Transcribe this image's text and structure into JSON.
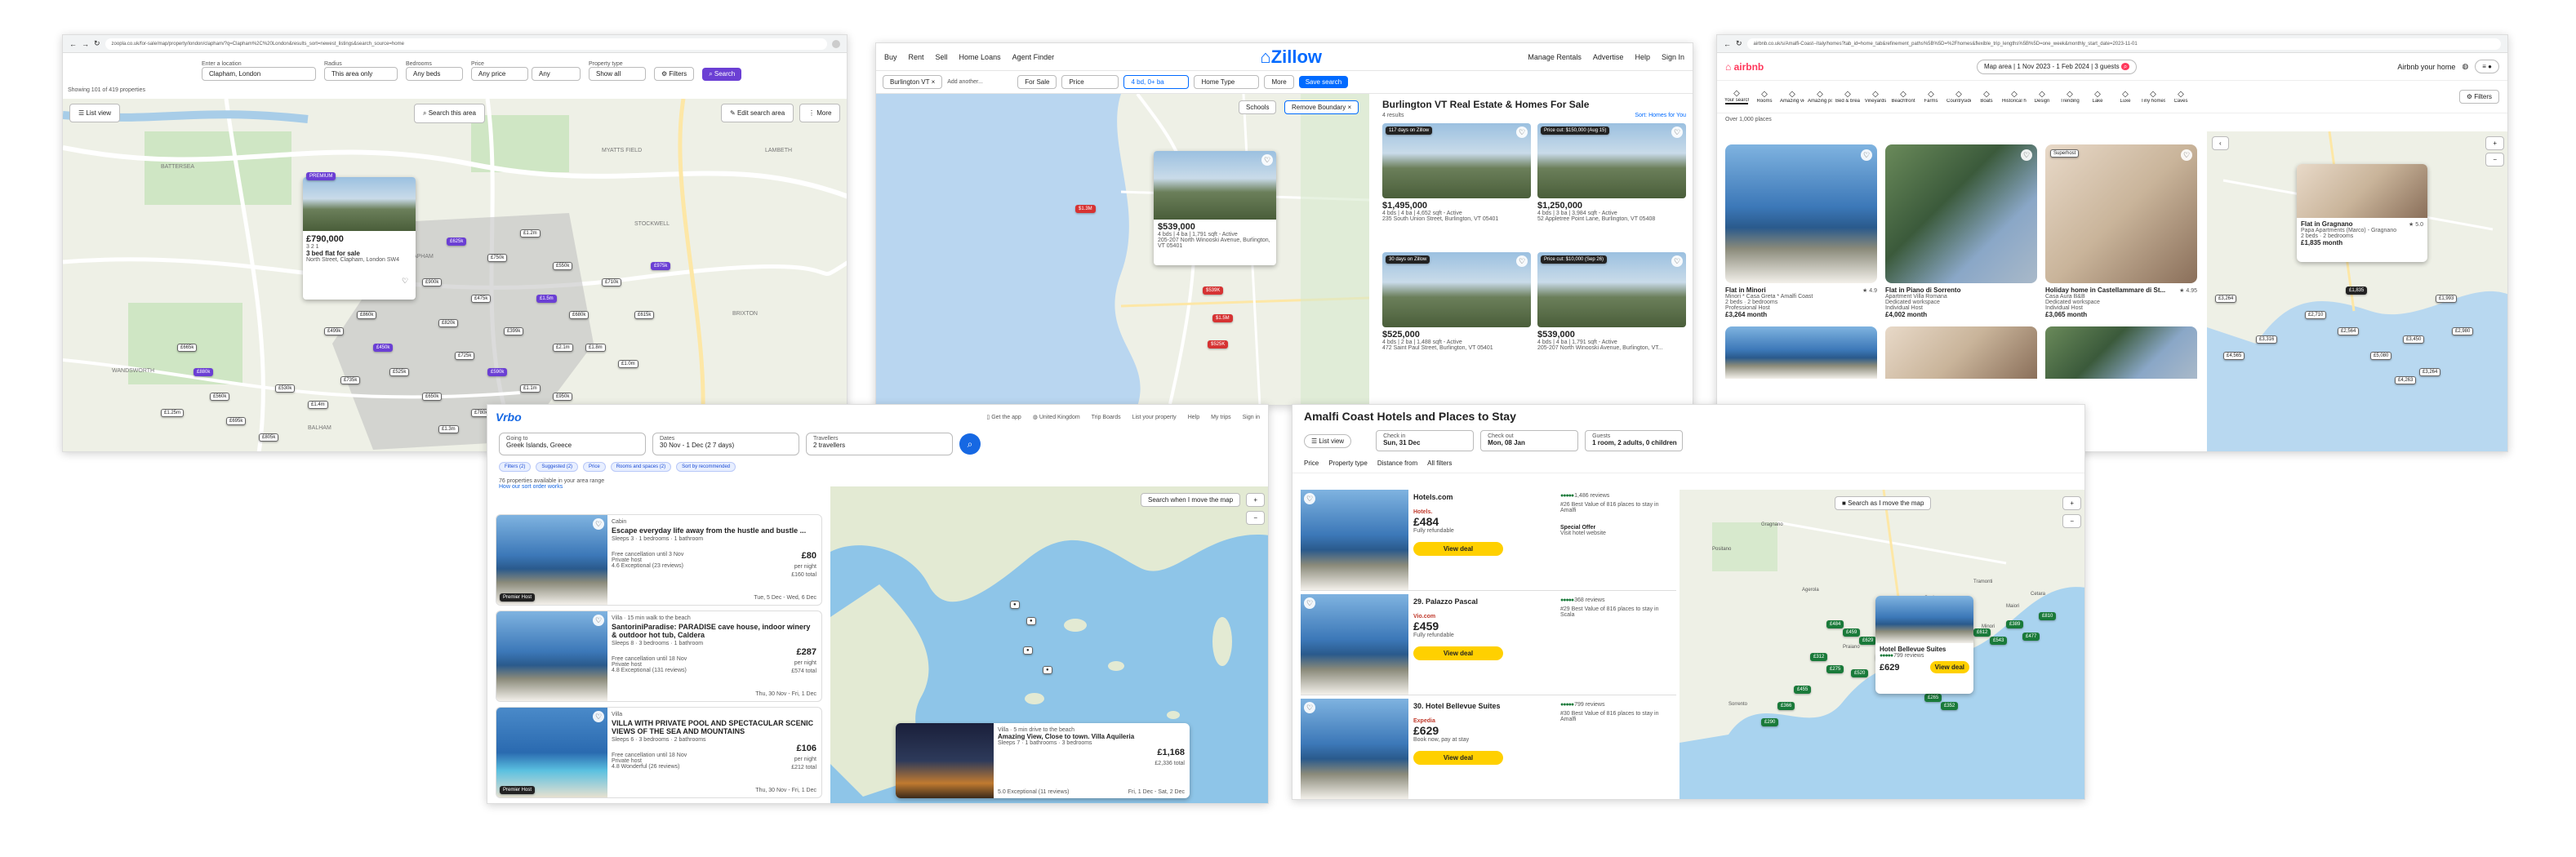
{
  "zoopla": {
    "url": "zoopla.co.uk/for-sale/map/property/london/clapham/?q=Clapham%2C%20London&results_sort=newest_listings&search_source=home",
    "location_label": "Enter a location",
    "location_value": "Clapham, London",
    "radius_label": "Radius",
    "radius_value": "This area only",
    "bedrooms_label": "Bedrooms",
    "bedrooms_value": "Any beds",
    "price_label": "Price",
    "price_min": "Any price",
    "price_max": "Any",
    "property_type_label": "Property type",
    "property_type_value": "Show all",
    "filters_label": "Filters",
    "search_label": "Search",
    "results_count": "Showing 101 of 419 properties",
    "list_view": "List view",
    "search_area": "Search this area",
    "edit_search": "Edit search area",
    "more": "More",
    "card_badge": "PREMIUM",
    "card_price": "£790,000",
    "card_features": "3  2  1",
    "card_title": "3 bed flat for sale",
    "card_address": "North Street, Clapham, London SW4",
    "pins": [
      "£625k",
      "£750k",
      "£1.2m",
      "£550k",
      "£900k",
      "£475k",
      "£1.5m",
      "£680k",
      "£820k",
      "£399k",
      "£2.1m",
      "£725k",
      "£590k",
      "£1.1m",
      "£650k",
      "£950k",
      "£780k",
      "£1.3m",
      "£450k",
      "£860k",
      "£525k",
      "£1.8m",
      "£710k",
      "£615k",
      "£975k",
      "£1.0m",
      "£735k",
      "£499k",
      "£1.4m",
      "£665k",
      "£880k",
      "£560k",
      "£1.25m",
      "£695k",
      "£805k",
      "£530k"
    ],
    "districts": [
      "BATTERSEA",
      "CLAPHAM",
      "STOCKWELL",
      "BRIXTON",
      "BALHAM",
      "WANDSWORTH",
      "MYATTS FIELD",
      "LAMBETH"
    ]
  },
  "zillow": {
    "nav": [
      "Buy",
      "Rent",
      "Sell",
      "Home Loans",
      "Agent Finder"
    ],
    "logo": "Zillow",
    "nav_right": [
      "Manage Rentals",
      "Advertise",
      "Help",
      "Sign In"
    ],
    "search_chip": "Burlington VT",
    "search_placeholder": "Add another...",
    "filters": [
      "For Sale",
      "Price",
      "4 bd, 0+ ba",
      "Home Type",
      "More"
    ],
    "save_search": "Save search",
    "schools": "Schools",
    "remove_boundary": "Remove Boundary",
    "heading": "Burlington VT Real Estate & Homes For Sale",
    "results": "4 results",
    "sort": "Sort: Homes for You",
    "map_popup_price": "$539,000",
    "map_popup_details": "4 bds | 4 ba | 1,791 sqft - Active",
    "map_popup_address": "205-207 North Winooski Avenue, Burlington, VT 05401",
    "map_pins": [
      "$1.3M",
      "$1.5M",
      "$525K",
      "$539K"
    ],
    "listings": [
      {
        "badge": "117 days on Zillow",
        "price": "$1,495,000",
        "details": "4 bds | 4 ba | 4,652 sqft - Active",
        "address": "235 South Union Street, Burlington, VT 05401"
      },
      {
        "badge": "Price cut: $150,000 (Aug 15)",
        "price": "$1,250,000",
        "details": "4 bds | 3 ba | 3,984 sqft - Active",
        "address": "52 Appletree Point Lane, Burlington, VT 05408"
      },
      {
        "badge": "30 days on Zillow",
        "price": "$525,000",
        "details": "4 bds | 2 ba | 1,488 sqft - Active",
        "address": "472 Saint Paul Street, Burlington, VT 05401"
      },
      {
        "badge": "Price cut: $10,000 (Sep 26)",
        "price": "$539,000",
        "details": "4 bds | 4 ba | 1,791 sqft - Active",
        "address": "205-207 North Winooski Avenue, Burlington, VT..."
      }
    ]
  },
  "airbnb": {
    "url": "airbnb.co.uk/s/Amalfi-Coast--Italy/homes?tab_id=home_tab&refinement_paths%5B%5D=%2Fhomes&flexible_trip_lengths%5B%5D=one_week&monthly_start_date=2023-11-01",
    "logo": "airbnb",
    "search_pill": [
      "Map area",
      "1 Nov 2023 - 1 Feb 2024",
      "3 guests"
    ],
    "airbnb_your_home": "Airbnb your home",
    "categories": [
      "Your search",
      "Rooms",
      "Amazing views",
      "Amazing pools",
      "Bed & breakfasts",
      "Vineyards",
      "Beachfront",
      "Farms",
      "Countryside",
      "Boats",
      "Historical homes",
      "Design",
      "Trending",
      "Lake",
      "Luxe",
      "Tiny homes",
      "Caves"
    ],
    "filters": "Filters",
    "places_count": "Over 1,000 places",
    "listings": [
      {
        "title": "Flat in Minori",
        "rating": "4.9",
        "desc": "Minori * Casa Greta * Amalfi Coast",
        "beds": "2 beds · 2 bedrooms",
        "host": "Professional Host",
        "price": "£3,264 month",
        "badge": ""
      },
      {
        "title": "Flat in Piano di Sorrento",
        "rating": "",
        "desc": "Apartment Villa Romana",
        "beds": "Dedicated workspace",
        "host": "Individual Host",
        "price": "£4,002 month",
        "badge": ""
      },
      {
        "title": "Holiday home in Castellammare di St...",
        "rating": "4.95",
        "desc": "Casa Aura B&B",
        "beds": "Dedicated workspace",
        "host": "Individual Host",
        "price": "£3,065 month",
        "badge": "Superhost"
      }
    ],
    "map_popup_title": "Flat in Gragnano",
    "map_popup_rating": "5.0",
    "map_popup_desc": "Papa Apartments (Marco) - Gragnano",
    "map_popup_beds": "2 beds · 2 bedrooms",
    "map_popup_price": "£1,835 month",
    "map_pins": [
      "£1,835",
      "£1,993",
      "£3,264",
      "£2,710",
      "£2,564",
      "£3,316",
      "£4,565",
      "£3,450",
      "£2,980",
      "£5,080",
      "£3,264",
      "£4,263"
    ]
  },
  "vrbo": {
    "logo": "Vrbo",
    "nav": [
      "Get the app",
      "United Kingdom",
      "Trip Boards",
      "List your property",
      "Help",
      "My trips",
      "Sign in"
    ],
    "going_to_label": "Going to",
    "going_to_value": "Greek Islands, Greece",
    "dates_label": "Dates",
    "dates_value": "30 Nov - 1 Dec (2 7 days)",
    "travellers_label": "Travellers",
    "travellers_value": "2 travellers",
    "filter_chips": [
      "Filters (2)",
      "Suggested (2)",
      "Price",
      "Rooms and spaces (2)",
      "Sort by recommended"
    ],
    "count": "76 properties available in your area range",
    "sub_count": "How our sort order works",
    "search_as_move": "Search when I move the map",
    "listings": [
      {
        "type": "Cabin",
        "title": "Escape everyday life away from the hustle and bustle ...",
        "sleeps": "Sleeps 3 · 1 bedrooms · 1 bathroom",
        "cancel": "Free cancellation until 3 Nov",
        "pool": "Private host",
        "rating": "4.6 Exceptional (23 reviews)",
        "price": "£80",
        "price_sub": "per night",
        "total": "£160 total",
        "dates": "Tue, 5 Dec - Wed, 6 Dec",
        "badge": "Premier Host"
      },
      {
        "type": "Villa · 15 min walk to the beach",
        "title": "SantoriniParadise: PARADISE cave house, indoor winery & outdoor hot tub, Caldera",
        "sleeps": "Sleeps 8 · 3 bedrooms · 1 bathroom",
        "cancel": "Free cancellation until 18 Nov",
        "pool": "Private host",
        "rating": "4.8 Exceptional (131 reviews)",
        "price": "£287",
        "price_sub": "per night",
        "total": "£574 total",
        "dates": "Thu, 30 Nov - Fri, 1 Dec",
        "badge": ""
      },
      {
        "type": "Villa",
        "title": "VILLA WITH PRIVATE POOL AND SPECTACULAR SCENIC VIEWS OF THE SEA AND MOUNTAINS",
        "sleeps": "Sleeps 6 · 3 bedrooms · 2 bathrooms",
        "cancel": "Free cancellation until 18 Nov",
        "pool": "Private host",
        "rating": "4.8 Wonderful (26 reviews)",
        "price": "£106",
        "price_sub": "per night",
        "total": "£212 total",
        "dates": "Thu, 30 Nov - Fri, 1 Dec",
        "badge": "Premier Host"
      }
    ],
    "map_card_type": "Villa · 5 min drive to the beach",
    "map_card_title": "Amazing View, Close to town. Villa Aquileria",
    "map_card_sleeps": "Sleeps 7 · 1 bathrooms · 3 bedrooms",
    "map_card_price": "£1,168",
    "map_card_total": "£2,336 total",
    "map_card_rating": "5.0 Exceptional (11 reviews)",
    "map_card_dates": "Fri, 1 Dec - Sat, 2 Dec"
  },
  "hotels": {
    "title": "Amalfi Coast Hotels and Places to Stay",
    "list_view": "List view",
    "checkin_label": "Check in",
    "checkin_value": "Sun, 31 Dec",
    "checkout_label": "Check out",
    "checkout_value": "Mon, 08 Jan",
    "guests_label": "Guests",
    "guests_value": "1 room, 2 adults, 0 children",
    "filters": [
      "Price",
      "Property type",
      "Distance from",
      "All filters"
    ],
    "search_move": "Search as I move the map",
    "results": [
      {
        "num": "",
        "name": "Hotels.com",
        "provider": "Hotels.",
        "price": "£484",
        "sub": "Fully refundable",
        "rating": "1,486 reviews",
        "note": "#26 Best Value of 816 places to stay in Amalfi",
        "special": "Special Offer",
        "visit": "Visit hotel website",
        "deal": "View deal"
      },
      {
        "num": "29.",
        "name": "29. Palazzo Pascal",
        "provider": "Vio.com",
        "price": "£459",
        "sub": "Fully refundable",
        "rating": "368 reviews",
        "note": "#29 Best Value of 816 places to stay in Scala",
        "special": "",
        "visit": "",
        "deal": "View deal"
      },
      {
        "num": "30.",
        "name": "30. Hotel Bellevue Suites",
        "provider": "Expedia",
        "price": "£629",
        "sub": "Book now, pay at stay",
        "rating": "799 reviews",
        "note": "#30 Best Value of 816 places to stay in Amalfi",
        "special": "",
        "visit": "",
        "deal": "View deal"
      }
    ],
    "map_popup_name": "Hotel Bellevue Suites",
    "map_popup_reviews": "799 reviews",
    "map_popup_price": "£629",
    "map_popup_deal": "View deal",
    "map_pins": [
      "£484",
      "£459",
      "£629",
      "£312",
      "£275",
      "£520",
      "£398",
      "£701",
      "£455",
      "£366",
      "£290",
      "£612",
      "£543",
      "£389",
      "£477",
      "£810",
      "£265",
      "£352"
    ],
    "places": [
      "Positano",
      "Amalfi",
      "Ravello",
      "Maiori",
      "Minori",
      "Scala",
      "Praiano",
      "Sorrento",
      "Gragnano",
      "Agerola",
      "Tramonti",
      "Cetara"
    ]
  },
  "colors": {
    "zoopla_purple": "#6b3fd4",
    "zillow_blue": "#006aff",
    "airbnb_red": "#ff385c",
    "vrbo_blue": "#1668e3",
    "hotel_yellow": "#ffd000",
    "tripadvisor_green": "#1a7a3a"
  }
}
